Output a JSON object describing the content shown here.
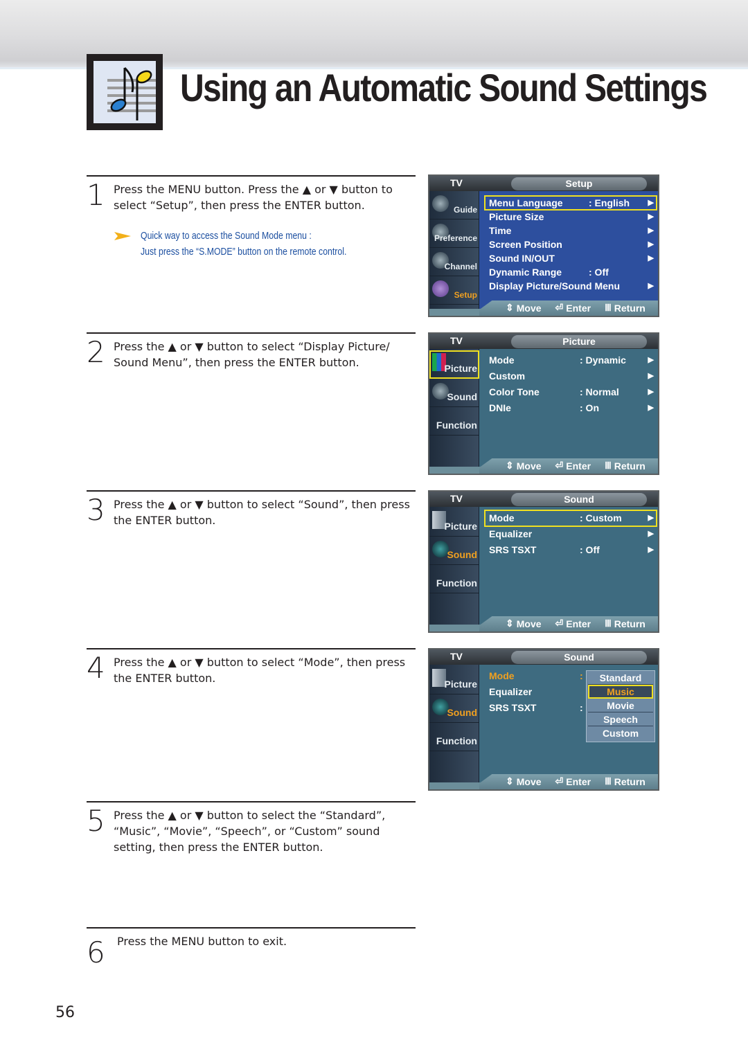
{
  "page": {
    "title": "Using an Automatic Sound Settings",
    "title_icon": "music-notes-icon",
    "page_number": "56"
  },
  "steps": [
    {
      "number": "1",
      "text": "Press the MENU button. Press the ▲ or ▼ button to select “Setup”, then press the ENTER button.",
      "note": {
        "icon": "arrow-right-icon",
        "line1": "Quick way to access the Sound Mode menu :",
        "line2": "Just press the “S.MODE” button on the remote control."
      }
    },
    {
      "number": "2",
      "text": "Press the ▲ or ▼ button to select “Display Picture/ Sound Menu”, then press the ENTER button."
    },
    {
      "number": "3",
      "text": "Press the ▲ or ▼ button to select “Sound”, then press the ENTER button."
    },
    {
      "number": "4",
      "text": "Press the ▲ or ▼ button to select “Mode”, then press the ENTER button."
    },
    {
      "number": "5",
      "text": "Press the ▲ or ▼ button to select the “Standard”, “Music”, “Movie”, “Speech”, or “Custom” sound setting, then press the ENTER button."
    },
    {
      "number": "6",
      "text": "Press the MENU button to exit."
    }
  ],
  "osd_common": {
    "tv_label": "TV",
    "nav": {
      "move": "Move",
      "enter": "Enter",
      "return": "Return"
    },
    "colors": {
      "highlight": "#f0e020",
      "active_text": "#f0a020"
    }
  },
  "osd_screens": [
    {
      "title": "Setup",
      "sidebar": [
        "Guide",
        "Preference",
        "Channel",
        "Setup"
      ],
      "sidebar_active": "Setup",
      "rows": [
        {
          "label": "Menu Language",
          "value": ": English",
          "arrow": "▶",
          "highlighted": true
        },
        {
          "label": "Picture Size",
          "value": "",
          "arrow": "▶"
        },
        {
          "label": "Time",
          "value": "",
          "arrow": "▶"
        },
        {
          "label": "Screen Position",
          "value": "",
          "arrow": "▶"
        },
        {
          "label": "Sound IN/OUT",
          "value": "",
          "arrow": "▶"
        },
        {
          "label": "Dynamic Range",
          "value": ": Off",
          "arrow": ""
        },
        {
          "label": "Display Picture/Sound Menu",
          "value": "",
          "arrow": "▶"
        }
      ]
    },
    {
      "title": "Picture",
      "sidebar": [
        "Picture",
        "Sound",
        "Function"
      ],
      "sidebar_active": "Picture",
      "rows": [
        {
          "label": "Mode",
          "value": ": Dynamic",
          "arrow": "▶"
        },
        {
          "label": "Custom",
          "value": "",
          "arrow": "▶"
        },
        {
          "label": "Color Tone",
          "value": ": Normal",
          "arrow": "▶"
        },
        {
          "label": "DNIe",
          "value": ": On",
          "arrow": "▶"
        }
      ]
    },
    {
      "title": "Sound",
      "sidebar": [
        "Picture",
        "Sound",
        "Function"
      ],
      "sidebar_active": "Sound",
      "rows": [
        {
          "label": "Mode",
          "value": ": Custom",
          "arrow": "▶",
          "highlighted": true
        },
        {
          "label": "Equalizer",
          "value": "",
          "arrow": "▶"
        },
        {
          "label": "SRS TSXT",
          "value": ": Off",
          "arrow": "▶"
        }
      ]
    },
    {
      "title": "Sound",
      "sidebar": [
        "Picture",
        "Sound",
        "Function"
      ],
      "sidebar_active": "Sound",
      "rows": [
        {
          "label": "Mode",
          "value": ":",
          "arrow": ""
        },
        {
          "label": "Equalizer",
          "value": "",
          "arrow": ""
        },
        {
          "label": "SRS TSXT",
          "value": ":",
          "arrow": ""
        }
      ],
      "popup_options": [
        "Standard",
        "Music",
        "Movie",
        "Speech",
        "Custom"
      ],
      "popup_selected": "Music"
    }
  ]
}
